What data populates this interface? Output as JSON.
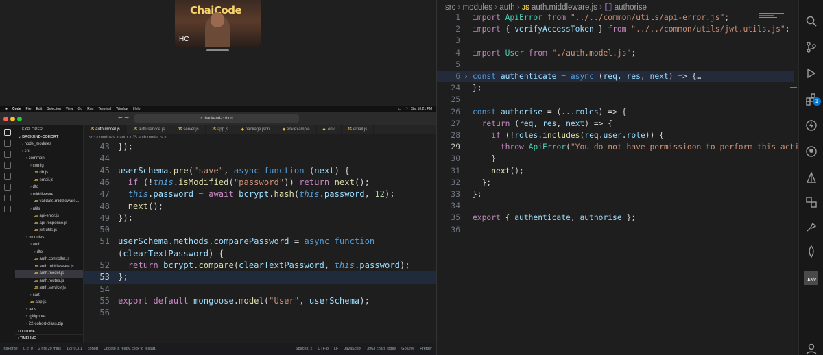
{
  "webcam": {
    "logo_text": "ChaiCode",
    "initials": "HC"
  },
  "mac_menu": {
    "items": [
      "Code",
      "File",
      "Edit",
      "Selection",
      "View",
      "Go",
      "Run",
      "Terminal",
      "Window",
      "Help"
    ],
    "clock": "Sat 10:21 PM"
  },
  "window": {
    "search": "backend-cohort"
  },
  "explorer": {
    "header": "EXPLORER",
    "root": "BACKEND-COHORT",
    "tree": [
      {
        "label": "node_modules",
        "type": "folder"
      },
      {
        "label": "src",
        "type": "folder"
      },
      {
        "label": "common",
        "type": "folder"
      },
      {
        "label": "config",
        "type": "folder"
      },
      {
        "label": "db.js",
        "type": "js"
      },
      {
        "label": "email.js",
        "type": "js"
      },
      {
        "label": "dto",
        "type": "folder"
      },
      {
        "label": "middleware",
        "type": "folder"
      },
      {
        "label": "validate.middleware...",
        "type": "js"
      },
      {
        "label": "utils",
        "type": "folder"
      },
      {
        "label": "api-error.js",
        "type": "js"
      },
      {
        "label": "api-response.js",
        "type": "js"
      },
      {
        "label": "jwt.utils.js",
        "type": "js"
      },
      {
        "label": "modules",
        "type": "folder"
      },
      {
        "label": "auth",
        "type": "folder"
      },
      {
        "label": "dto",
        "type": "folder"
      },
      {
        "label": "auth.controller.js",
        "type": "js"
      },
      {
        "label": "auth.middleware.js",
        "type": "js"
      },
      {
        "label": "auth.model.js",
        "type": "js"
      },
      {
        "label": "auth.routes.js",
        "type": "js"
      },
      {
        "label": "auth.service.js",
        "type": "js"
      },
      {
        "label": "cart",
        "type": "folder"
      },
      {
        "label": "app.js",
        "type": "js"
      },
      {
        "label": ".env",
        "type": "file"
      },
      {
        "label": ".gitignore",
        "type": "file"
      },
      {
        "label": "22-cohort-class.zip",
        "type": "file"
      }
    ],
    "outline": "OUTLINE",
    "timeline": "TIMELINE"
  },
  "tabs": [
    "auth.model.js",
    "auth.service.js",
    "server.js",
    "app.js",
    "package.json",
    "env.example",
    ".env",
    "email.js"
  ],
  "left_breadcrumb": "src > modules > auth > JS auth.model.js > ...",
  "left_code": [
    {
      "n": "43",
      "t": "});"
    },
    {
      "n": "44",
      "t": ""
    },
    {
      "n": "45",
      "t": "userSchema.pre(\"save\", async function (next) {"
    },
    {
      "n": "46",
      "t": "  if (!this.isModified(\"password\")) return next();"
    },
    {
      "n": "47",
      "t": "  this.password = await bcrypt.hash(this.password, 12);"
    },
    {
      "n": "48",
      "t": "  next();"
    },
    {
      "n": "49",
      "t": "});"
    },
    {
      "n": "50",
      "t": ""
    },
    {
      "n": "51",
      "t": "userSchema.methods.comparePassword = async function"
    },
    {
      "n": "",
      "t": "(clearTextPassword) {"
    },
    {
      "n": "52",
      "t": "  return bcrypt.compare(clearTextPassword, this.password);"
    },
    {
      "n": "53",
      "t": "};"
    },
    {
      "n": "54",
      "t": ""
    },
    {
      "n": "55",
      "t": "export default mongoose.model(\"User\", userSchema);"
    },
    {
      "n": "56",
      "t": ""
    }
  ],
  "left_status": {
    "branch": "InsForge",
    "problems": "0 ⚠ 0",
    "time": "2 hrs 29 mins",
    "host": "127.0.0.1",
    "folder": "cohort",
    "update": "Update is ready, click to restart.",
    "spaces": "Spaces: 2",
    "encoding": "UTF-8",
    "eol": "LF",
    "language": "JavaScript",
    "chars": "3963 chars today",
    "golive": "Go Live",
    "prettier": "Prettier"
  },
  "right_breadcrumb": {
    "parts": [
      "src",
      "modules",
      "auth",
      "auth.middleware.js",
      "authorise"
    ]
  },
  "right_code": [
    {
      "n": "1",
      "t": "import ApiError from \"../../common/utils/api-error.js\";"
    },
    {
      "n": "2",
      "t": "import { verifyAccessToken } from \"../../common/utils/jwt.utils.js\";"
    },
    {
      "n": "3",
      "t": ""
    },
    {
      "n": "4",
      "t": "import User from \"./auth.model.js\";"
    },
    {
      "n": "5",
      "t": ""
    },
    {
      "n": "6",
      "t": "const authenticate = async (req, res, next) => {…"
    },
    {
      "n": "24",
      "t": "};"
    },
    {
      "n": "25",
      "t": ""
    },
    {
      "n": "26",
      "t": "const authorise = (...roles) => {"
    },
    {
      "n": "27",
      "t": "  return (req, res, next) => {"
    },
    {
      "n": "28",
      "t": "    if (!roles.includes(req.user.role)) {"
    },
    {
      "n": "29",
      "t": "      throw ApiError(\"You do not have permissioon to perform this action\");"
    },
    {
      "n": "30",
      "t": "    }"
    },
    {
      "n": "31",
      "t": "    next();"
    },
    {
      "n": "32",
      "t": "  };"
    },
    {
      "n": "33",
      "t": "};"
    },
    {
      "n": "34",
      "t": ""
    },
    {
      "n": "35",
      "t": "export { authenticate, authorise };"
    },
    {
      "n": "36",
      "t": ""
    }
  ],
  "right_activity": {
    "icons": [
      "search-icon",
      "source-control-icon",
      "run-debug-icon",
      "extensions-icon",
      "thunder-client-icon",
      "github-icon",
      "deploy-icon",
      "remote-explorer-icon",
      "postman-icon",
      "mongodb-icon",
      "env-icon",
      "account-icon"
    ],
    "extensions_badge": "1",
    "env_label": ".ENV"
  },
  "colors": {
    "background": "#1e1e1e",
    "keyword": "#569cd6",
    "control": "#c586c0",
    "function": "#dcdcaa",
    "string": "#ce9178",
    "variable": "#9cdcfe",
    "class": "#4ec9b0",
    "number": "#b5cea8",
    "badge": "#0078d4"
  }
}
